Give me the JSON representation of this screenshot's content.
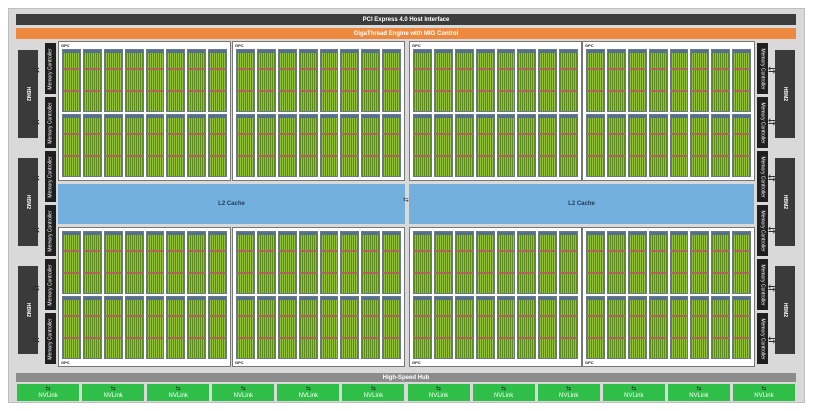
{
  "pcie_label": "PCI Express 4.0 Host Interface",
  "gigathread_label": "GigaThread Engine with MIG Control",
  "gpc_label": "GPC",
  "memory_controller_label": "Memory Controller",
  "hbm_label": "HBM2",
  "l2_cache_label": "L2 Cache",
  "high_speed_hub_label": "High-Speed Hub",
  "nvlink_label": "NVLink",
  "nvlink_count": 12,
  "gpc_count": 8,
  "sm_per_gpc": 16,
  "colors": {
    "gigathread": "#ee8a3f",
    "l2_cache": "#74b0dd",
    "nvlink": "#2fbf48",
    "pcie": "#3c3c3c",
    "sm_core": "#7fa63a"
  }
}
